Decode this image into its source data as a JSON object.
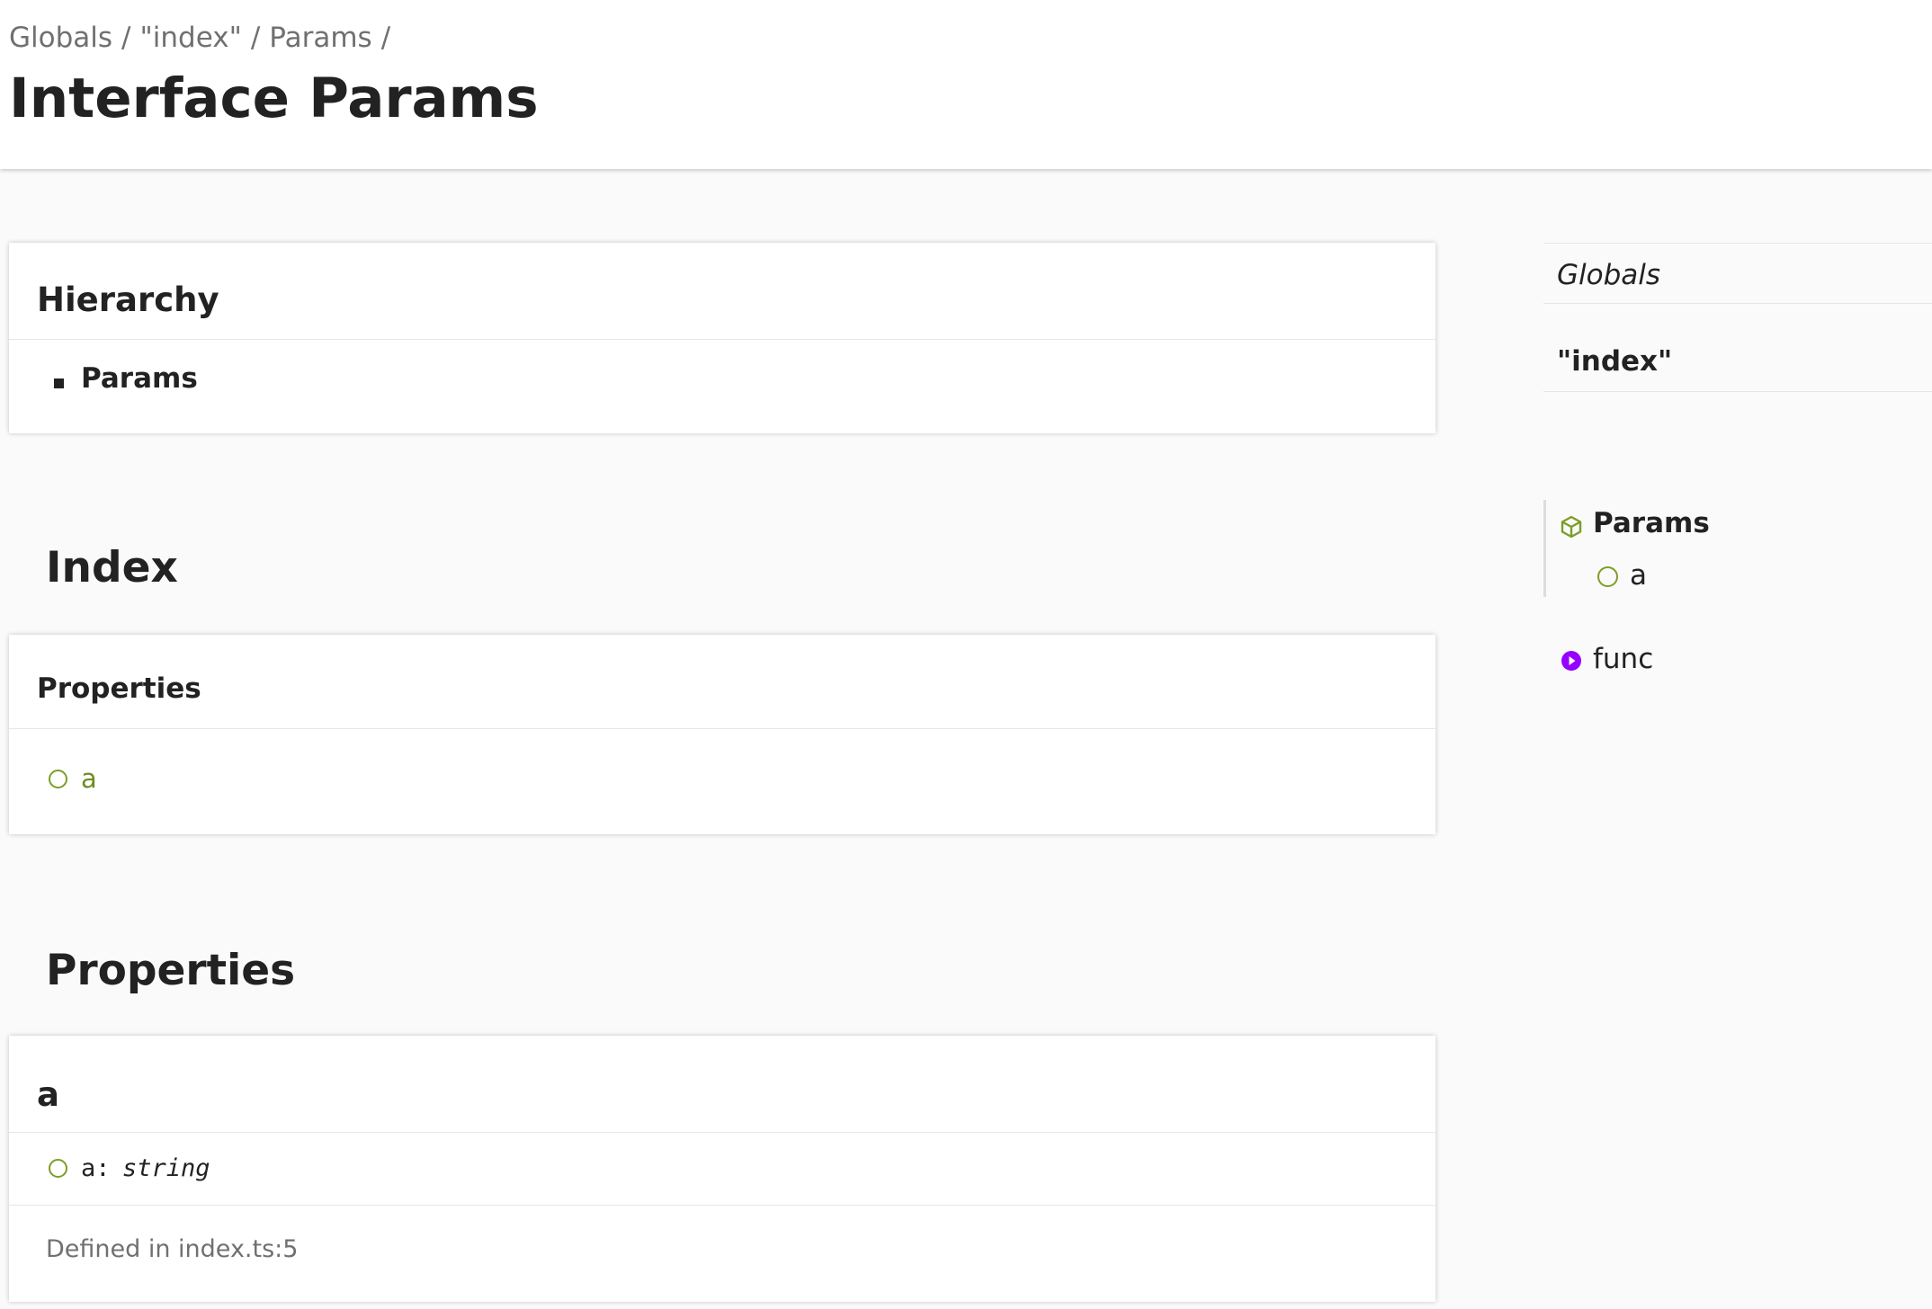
{
  "breadcrumb": {
    "items": [
      "Globals",
      "\"index\"",
      "Params"
    ],
    "separator": "/"
  },
  "page_title": "Interface Params",
  "hierarchy": {
    "title": "Hierarchy",
    "items": [
      "Params"
    ]
  },
  "index_section": {
    "heading": "Index",
    "group_title": "Properties",
    "items": [
      "a"
    ]
  },
  "properties_section": {
    "heading": "Properties",
    "members": [
      {
        "name": "a",
        "signature_name": "a:",
        "signature_type": "string",
        "defined_in": "Defined in index.ts:5"
      }
    ]
  },
  "sidebar": {
    "globals": "Globals",
    "module": "\"index\"",
    "interface": {
      "label": "Params",
      "icon": "interface-cube-icon",
      "members": [
        "a"
      ]
    },
    "functions": [
      {
        "label": "func",
        "icon": "function-icon"
      }
    ]
  },
  "colors": {
    "property_green": "#7b9e27",
    "function_purple": "#9600ff",
    "text": "#222222",
    "muted": "#707070"
  }
}
